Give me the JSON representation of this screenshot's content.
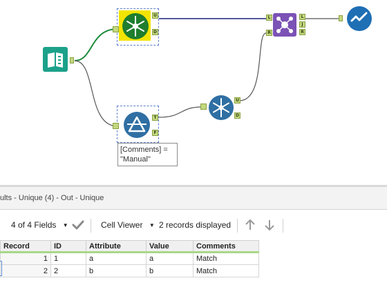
{
  "workflow": {
    "anchors": {
      "unique_u": "U",
      "unique_d": "D",
      "join_l": "L",
      "join_r": "R",
      "join_out_l": "L",
      "join_out_j": "J",
      "join_out_r": "R",
      "filter_t": "T",
      "filter_f": "F",
      "unique2_u": "U",
      "unique2_d": "D"
    },
    "filter_expression_line1": "[Comments] =",
    "filter_expression_line2": "\"Manual\"",
    "tools": {
      "input": "input-data-icon",
      "unique1": "unique-icon",
      "filter": "filter-icon",
      "unique2": "unique-icon",
      "join": "join-icon",
      "browse": "browse-icon"
    },
    "colors": {
      "input": "#1ca18a",
      "unique": "#1e7e2e",
      "filter": "#2f6fa3",
      "join": "#7b52b5",
      "browse": "#1f6fb5",
      "selected_bg": "#f2e400"
    }
  },
  "results": {
    "title": "ults - Unique (4) - Out - Unique",
    "fields_label": "4 of 4 Fields",
    "viewer_label": "Cell Viewer",
    "records_label": "2 records displayed"
  },
  "grid": {
    "columns": [
      "Record",
      "ID",
      "Attribute",
      "Value",
      "Comments"
    ],
    "rows": [
      [
        "1",
        "1",
        "a",
        "a",
        "Match"
      ],
      [
        "2",
        "2",
        "b",
        "b",
        "Match"
      ]
    ]
  }
}
